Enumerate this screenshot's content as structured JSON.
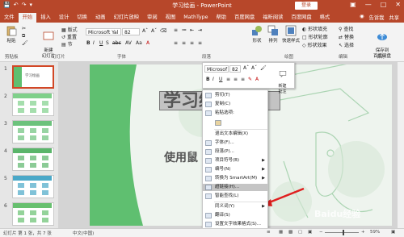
{
  "title_bar": {
    "title": "学习绘画 - PowerPoint",
    "login": "登录",
    "accent": "#b7472a"
  },
  "tabs": [
    "文件",
    "开始",
    "插入",
    "设计",
    "切换",
    "动画",
    "幻灯片放映",
    "审阅",
    "视图",
    "MathType",
    "帮助",
    "百度网盘",
    "福昕阅读",
    "百度网盘",
    "格式"
  ],
  "active_tab_index": 1,
  "tabs_right": {
    "lightbulb": "告诉我",
    "share": "共享"
  },
  "ribbon": {
    "paste": "粘贴",
    "clipboard_group": "剪贴板",
    "new_slide": "新建\n幻灯片",
    "layout": "版式",
    "reset": "重置",
    "section": "节",
    "slides_group": "幻灯片",
    "font_name": "Microsoft Yal",
    "font_size": "82",
    "font_group": "字体",
    "paragraph_group": "段落",
    "shape": "形状",
    "arrange": "排列",
    "quick_styles": "快速样式",
    "shape_fill": "形状填充",
    "shape_outline": "形状轮廓",
    "shape_effects": "形状效果",
    "drawing_group": "绘图",
    "find": "查找",
    "replace": "替换",
    "select": "选择",
    "editing_group": "编辑",
    "save_baidu": "保存到\n百度网盘",
    "save_group": "保存"
  },
  "thumbnails": [
    {
      "num": "1",
      "label": "学习绘画"
    },
    {
      "num": "2",
      "label": ""
    },
    {
      "num": "3",
      "label": ""
    },
    {
      "num": "4",
      "label": ""
    },
    {
      "num": "5",
      "label": ""
    },
    {
      "num": "6",
      "label": ""
    }
  ],
  "slide": {
    "title": "学习绘",
    "subtitle": "使用鼠"
  },
  "mini_toolbar": {
    "font": "Microsof",
    "size": "82",
    "new_comment": "新建\n批注"
  },
  "context_menu": [
    {
      "label": "剪切(T)",
      "icon": "scissors-icon",
      "arrow": false
    },
    {
      "label": "复制(C)",
      "icon": "copy-icon",
      "arrow": false
    },
    {
      "label": "粘贴选项:",
      "icon": "paste-icon",
      "arrow": false
    },
    {
      "label": "",
      "icon": "paste-keep-text-icon",
      "arrow": false
    },
    {
      "label": "退出文本编辑(X)",
      "icon": "",
      "arrow": false
    },
    {
      "label": "字体(F)...",
      "icon": "font-icon",
      "arrow": false
    },
    {
      "label": "段落(P)...",
      "icon": "paragraph-icon",
      "arrow": false
    },
    {
      "label": "项目符号(B)",
      "icon": "bullets-icon",
      "arrow": true
    },
    {
      "label": "编号(N)",
      "icon": "numbering-icon",
      "arrow": true
    },
    {
      "label": "转换为 SmartArt(M)",
      "icon": "smartart-icon",
      "arrow": true
    },
    {
      "label": "超链接(H)...",
      "icon": "hyperlink-icon",
      "arrow": false,
      "highlight": true
    },
    {
      "label": "智能查找(L)",
      "icon": "search-icon",
      "arrow": false
    },
    {
      "label": "同义词(Y)",
      "icon": "",
      "arrow": true
    },
    {
      "label": "翻译(S)",
      "icon": "translate-icon",
      "arrow": false
    },
    {
      "label": "设置文字效果格式(S)...",
      "icon": "text-effects-icon",
      "arrow": false
    }
  ],
  "status": {
    "slide_info": "幻灯片 第 1 张，共 7 张",
    "language": "中文(中国)",
    "zoom": "59%"
  },
  "watermark": "Baidu经验"
}
